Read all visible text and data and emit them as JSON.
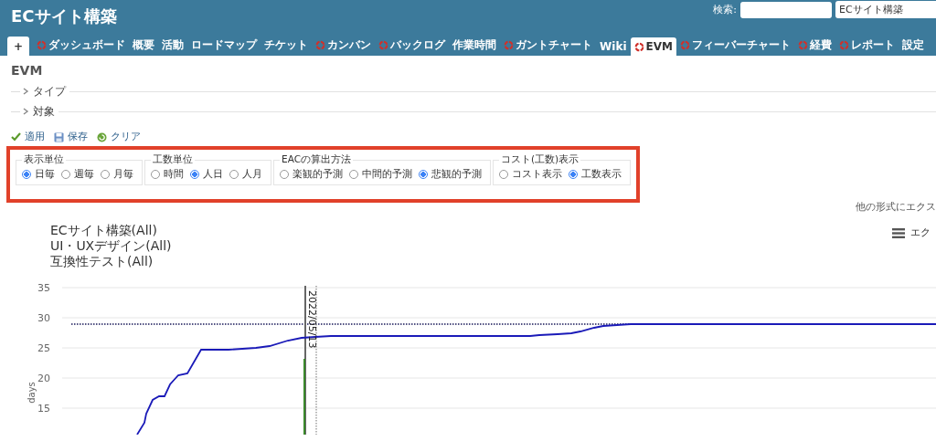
{
  "header": {
    "title": "ECサイト構築",
    "search_label": "検索:",
    "project_select": "ECサイト構築"
  },
  "tabs": [
    {
      "label": "+",
      "kind": "new",
      "selected": false
    },
    {
      "label": "ダッシュボード",
      "kind": "tab",
      "selected": false,
      "has_icon": true
    },
    {
      "label": "概要",
      "kind": "tab",
      "selected": false,
      "has_icon": false
    },
    {
      "label": "活動",
      "kind": "tab",
      "selected": false,
      "has_icon": false
    },
    {
      "label": "ロードマップ",
      "kind": "tab",
      "selected": false,
      "has_icon": false
    },
    {
      "label": "チケット",
      "kind": "tab",
      "selected": false,
      "has_icon": false
    },
    {
      "label": "カンバン",
      "kind": "tab",
      "selected": false,
      "has_icon": true
    },
    {
      "label": "バックログ",
      "kind": "tab",
      "selected": false,
      "has_icon": true
    },
    {
      "label": "作業時間",
      "kind": "tab",
      "selected": false,
      "has_icon": false
    },
    {
      "label": "ガントチャート",
      "kind": "tab",
      "selected": false,
      "has_icon": true
    },
    {
      "label": "Wiki",
      "kind": "tab",
      "selected": false,
      "has_icon": false
    },
    {
      "label": "EVM",
      "kind": "tab",
      "selected": true,
      "has_icon": true
    },
    {
      "label": "フィーバーチャート",
      "kind": "tab",
      "selected": false,
      "has_icon": true
    },
    {
      "label": "経費",
      "kind": "tab",
      "selected": false,
      "has_icon": true
    },
    {
      "label": "レポート",
      "kind": "tab",
      "selected": false,
      "has_icon": true
    },
    {
      "label": "設定",
      "kind": "tab",
      "selected": false,
      "has_icon": false
    }
  ],
  "page_title": "EVM",
  "filters": [
    {
      "label": "タイプ",
      "expanded": false
    },
    {
      "label": "対象",
      "expanded": false
    }
  ],
  "actions": [
    {
      "label": "適用",
      "kind": "apply"
    },
    {
      "label": "保存",
      "kind": "save"
    },
    {
      "label": "クリア",
      "kind": "clear"
    }
  ],
  "option_groups": [
    {
      "legend": "表示単位",
      "options": [
        {
          "label": "日毎",
          "selected": true
        },
        {
          "label": "週毎",
          "selected": false
        },
        {
          "label": "月毎",
          "selected": false
        }
      ]
    },
    {
      "legend": "工数単位",
      "options": [
        {
          "label": "時間",
          "selected": false
        },
        {
          "label": "人日",
          "selected": true
        },
        {
          "label": "人月",
          "selected": false
        }
      ]
    },
    {
      "legend": "EACの算出方法",
      "options": [
        {
          "label": "楽観的予測",
          "selected": false
        },
        {
          "label": "中間的予測",
          "selected": false
        },
        {
          "label": "悲観的予測",
          "selected": true
        }
      ]
    },
    {
      "legend": "コスト(工数)表示",
      "options": [
        {
          "label": "コスト表示",
          "selected": false
        },
        {
          "label": "工数表示",
          "selected": true
        }
      ]
    }
  ],
  "export_link": "他の形式にエクス",
  "chart": {
    "titles": [
      "ECサイト構築(All)",
      "UI・UXデザイン(All)",
      "互換性テスト(All)"
    ],
    "menu_label": "エク",
    "ylabel": "days",
    "yticks": [
      "35",
      "30",
      "25",
      "20",
      "15"
    ],
    "date_marker": "2022/05/13"
  }
}
